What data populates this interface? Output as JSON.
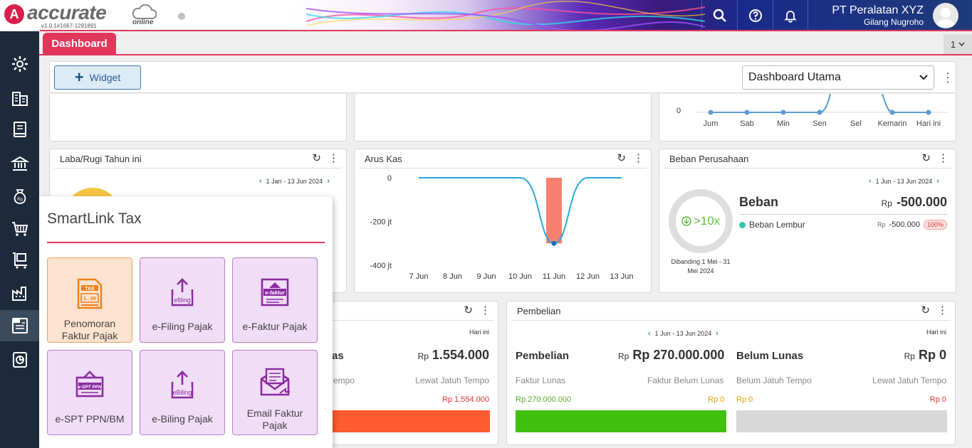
{
  "app": {
    "version": "v1.0.1#1667-1291891",
    "logo_text": "accurate",
    "logo_sub": "online"
  },
  "header": {
    "company": "PT Peralatan XYZ",
    "user": "Gilang Nugroho"
  },
  "tabs": {
    "active": "Dashboard",
    "count": "1"
  },
  "toolbar": {
    "widget_label": "Widget",
    "dashboard_select": "Dashboard Utama"
  },
  "top_chart": {
    "y_zero": "0",
    "days": [
      "Jum",
      "Sab",
      "Min",
      "Sen",
      "Sel",
      "Kemarin",
      "Hari ini"
    ]
  },
  "laba_rugi": {
    "title": "Laba/Rugi Tahun ini",
    "range": "1 Jan - 13 Jun 2024"
  },
  "arus_kas": {
    "title": "Arus Kas",
    "chart_data": {
      "type": "line",
      "x": [
        "7 Jun",
        "8 Jun",
        "9 Jun",
        "10 Jun",
        "11 Jun",
        "12 Jun",
        "13 Jun"
      ],
      "yticks": [
        "0",
        "-200 jt",
        "-400 jt"
      ],
      "ylim": [
        -400,
        0
      ],
      "bar_values": [
        0,
        0,
        0,
        0,
        -300,
        0,
        0
      ],
      "line_values": [
        0,
        0,
        0,
        0,
        -300,
        0,
        0
      ]
    }
  },
  "beban": {
    "title": "Beban Perusahaan",
    "range": "1 Jun - 13 Jun 2024",
    "ratio": ">10x",
    "compare": "Dibanding 1 Mei - 31 Mei 2024",
    "label": "Beban",
    "total_cur": "Rp",
    "total": "-500.000",
    "item_name": "Beban Lembur",
    "item_cur": "Rp",
    "item_value": "-500.000",
    "item_pct": "100%"
  },
  "penjualan": {
    "period": "Hari ini",
    "label_partial": "as",
    "total_cur": "Rp",
    "total": "1.554.000",
    "col1": "empo",
    "col2": "Lewat Jatuh Tempo",
    "val2": "Rp 1.554.000"
  },
  "pembelian": {
    "title": "Pembelian",
    "range": "1 Jun - 13 Jun 2024",
    "period": "Hari ini",
    "label": "Pembelian",
    "total_cur": "Rp",
    "total": "Rp 270.000.000",
    "label2": "Belum Lunas",
    "total2_cur": "Rp",
    "total2": "Rp 0",
    "h1": "Faktur Lunas",
    "h2": "Faktur Belum Lunas",
    "h3": "Belum Jatuh Tempo",
    "h4": "Lewat Jatuh Tempo",
    "v1": "Rp 270.000.000",
    "v2": "Rp 0",
    "v3": "Rp 0",
    "v4": "Rp 0"
  },
  "smartlink": {
    "title": "SmartLink Tax",
    "tiles": [
      {
        "label": "Penomoran Faktur Pajak",
        "icon_text": "TAX",
        "icon_sub": "1...99"
      },
      {
        "label": "e-Filing Pajak",
        "icon_text": "efiling"
      },
      {
        "label": "e-Faktur Pajak",
        "icon_text": "e-faktur"
      },
      {
        "label": "e-SPT PPN/BM",
        "icon_text": "e-SPT PPN"
      },
      {
        "label": "e-Biling Pajak",
        "icon_text": "eBiling"
      },
      {
        "label": "Email Faktur Pajak"
      }
    ]
  },
  "colors": {
    "accent": "#e2365b",
    "sidebar": "#1c2a3c",
    "red": "#e03030",
    "green": "#40c000",
    "orange": "#e5a000"
  }
}
